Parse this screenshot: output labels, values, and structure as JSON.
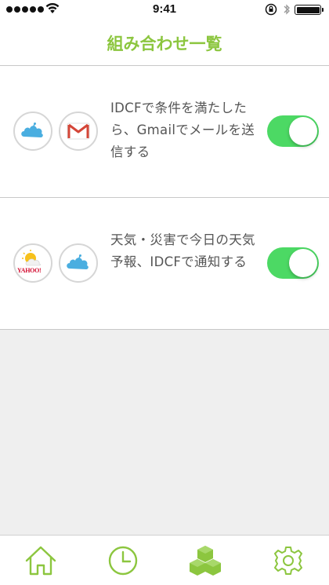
{
  "status_bar": {
    "time": "9:41",
    "signal_icon": "signal-dots-icon",
    "wifi_icon": "wifi-icon",
    "rotation_lock_icon": "rotation-lock-icon",
    "bluetooth_icon": "bluetooth-icon",
    "battery_icon": "battery-icon"
  },
  "nav": {
    "title": "組み合わせ一覧"
  },
  "combinations": [
    {
      "trigger_icon": "idcf-cloud-icon",
      "action_icon": "gmail-icon",
      "description": "IDCFで条件を満たしたら、Gmailでメールを送信する",
      "enabled": true
    },
    {
      "trigger_icon": "yahoo-weather-icon",
      "action_icon": "idcf-cloud-icon",
      "description": "天気・災害で今日の天気予報、IDCFで通知する",
      "enabled": true,
      "yahoo_logo_text": "YAHOO!"
    }
  ],
  "tab_bar": {
    "tabs": [
      {
        "icon": "home-icon",
        "selected": false
      },
      {
        "icon": "clock-icon",
        "selected": false
      },
      {
        "icon": "combinations-icon",
        "selected": true
      },
      {
        "icon": "gear-icon",
        "selected": false
      }
    ]
  },
  "colors": {
    "accent_green": "#8cc63f",
    "toggle_on": "#4cd964",
    "idcf_blue": "#4aaee0",
    "gmail_red": "#d44638",
    "background": "#efefef"
  }
}
